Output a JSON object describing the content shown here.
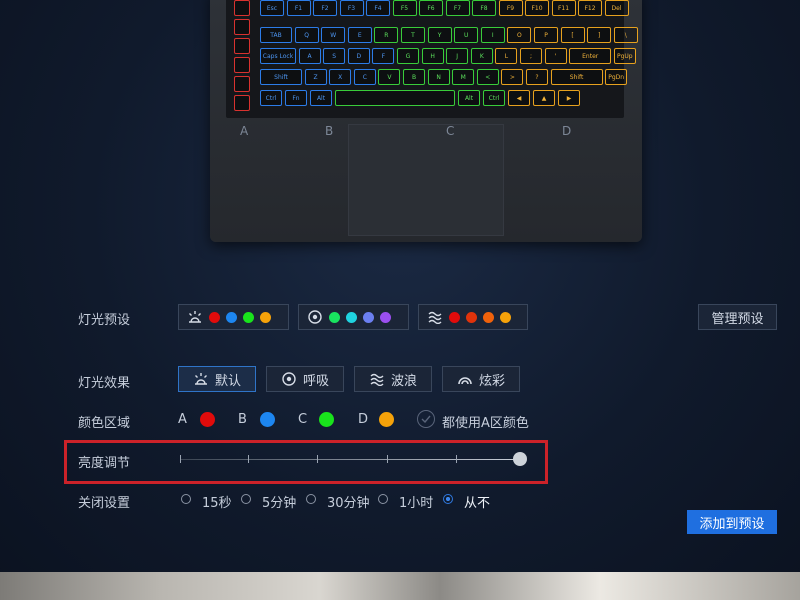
{
  "zones": {
    "labels": [
      "A",
      "B",
      "C",
      "D"
    ]
  },
  "colors": {
    "zone_a": "#e00b0b",
    "zone_b": "#1d86f0",
    "zone_c": "#19e31c",
    "zone_d": "#f5a20a",
    "accent": "#2f79e0",
    "highlight_border": "#cc2229"
  },
  "presets": {
    "label": "灯光预设",
    "items": [
      {
        "icon": "sun-rays-icon",
        "colors": [
          "#e00b0b",
          "#1d86f0",
          "#19e31c",
          "#f5a20a"
        ]
      },
      {
        "icon": "circle-dot-icon",
        "colors": [
          "#19e35f",
          "#1fd3e0",
          "#6b7ff0",
          "#9b4ff0"
        ]
      },
      {
        "icon": "wave-icon",
        "colors": [
          "#e00b0b",
          "#e0330b",
          "#f0620b",
          "#f5a20a"
        ]
      }
    ],
    "manage_button": "管理预设"
  },
  "effects": {
    "label": "灯光效果",
    "items": [
      {
        "label": "默认",
        "icon": "sun-rays-icon",
        "active": true
      },
      {
        "label": "呼吸",
        "icon": "circle-dot-icon",
        "active": false
      },
      {
        "label": "波浪",
        "icon": "wave-icon",
        "active": false
      },
      {
        "label": "炫彩",
        "icon": "rainbow-icon",
        "active": false
      }
    ]
  },
  "color_zones": {
    "label": "颜色区域",
    "items": [
      {
        "name": "A",
        "color": "#e00b0b"
      },
      {
        "name": "B",
        "color": "#1d86f0"
      },
      {
        "name": "C",
        "color": "#19e31c"
      },
      {
        "name": "D",
        "color": "#f5a20a"
      }
    ],
    "use_a_label": "都使用A区颜色"
  },
  "brightness": {
    "label": "亮度调节",
    "value": 1.0
  },
  "shutdown": {
    "label": "关闭设置",
    "options": [
      {
        "label": "15秒",
        "selected": false
      },
      {
        "label": "5分钟",
        "selected": false
      },
      {
        "label": "30分钟",
        "selected": false
      },
      {
        "label": "1小时",
        "selected": false
      },
      {
        "label": "从不",
        "selected": true
      }
    ]
  },
  "add_preset_button": "添加到预设",
  "keyboard": {
    "keys_zone_a": [
      "",
      "",
      "",
      "",
      "",
      "",
      ""
    ],
    "row_function": [
      "Esc",
      "F1",
      "F2",
      "F3",
      "F4",
      "F5",
      "F6",
      "F7",
      "F8",
      "F9",
      "F10",
      "F11",
      "F12",
      "Del"
    ],
    "row_tab": [
      "TAB",
      "Q",
      "W",
      "E",
      "R",
      "T",
      "Y",
      "U",
      "I",
      "O",
      "P",
      "[",
      "]",
      "\\"
    ],
    "row_caps": [
      "Caps Lock",
      "A",
      "S",
      "D",
      "F",
      "G",
      "H",
      "J",
      "K",
      "L",
      ";",
      "'",
      "Enter",
      "PgUp"
    ],
    "row_shift": [
      "Shift",
      "Z",
      "X",
      "C",
      "V",
      "B",
      "N",
      "M",
      "<",
      ">",
      "?",
      "Shift",
      "PgDn"
    ],
    "row_ctrl": [
      "Ctrl",
      "Fn",
      "Alt",
      "",
      "Alt",
      "Ctrl",
      "◀",
      "▲",
      "▶"
    ]
  }
}
